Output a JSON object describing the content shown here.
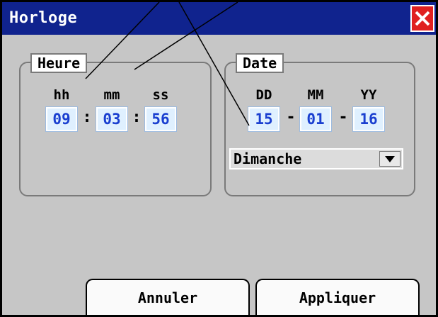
{
  "window": {
    "title": "Horloge"
  },
  "time_group": {
    "label": "Heure",
    "headers": [
      "hh",
      "mm",
      "ss"
    ],
    "values": [
      "09",
      "03",
      "56"
    ],
    "separator": ":"
  },
  "date_group": {
    "label": "Date",
    "headers": [
      "DD",
      "MM",
      "YY"
    ],
    "values": [
      "15",
      "01",
      "16"
    ],
    "separator": "-",
    "weekday": "Dimanche"
  },
  "buttons": {
    "cancel": "Annuler",
    "apply": "Appliquer"
  },
  "icons": {
    "close": "close-icon",
    "dropdown": "chevron-down-icon"
  },
  "colors": {
    "titlebar": "#10238e",
    "close": "#e02020",
    "field_bg": "#dff0ff",
    "field_text": "#1a3fd0",
    "panel": "#c6c6c6"
  }
}
